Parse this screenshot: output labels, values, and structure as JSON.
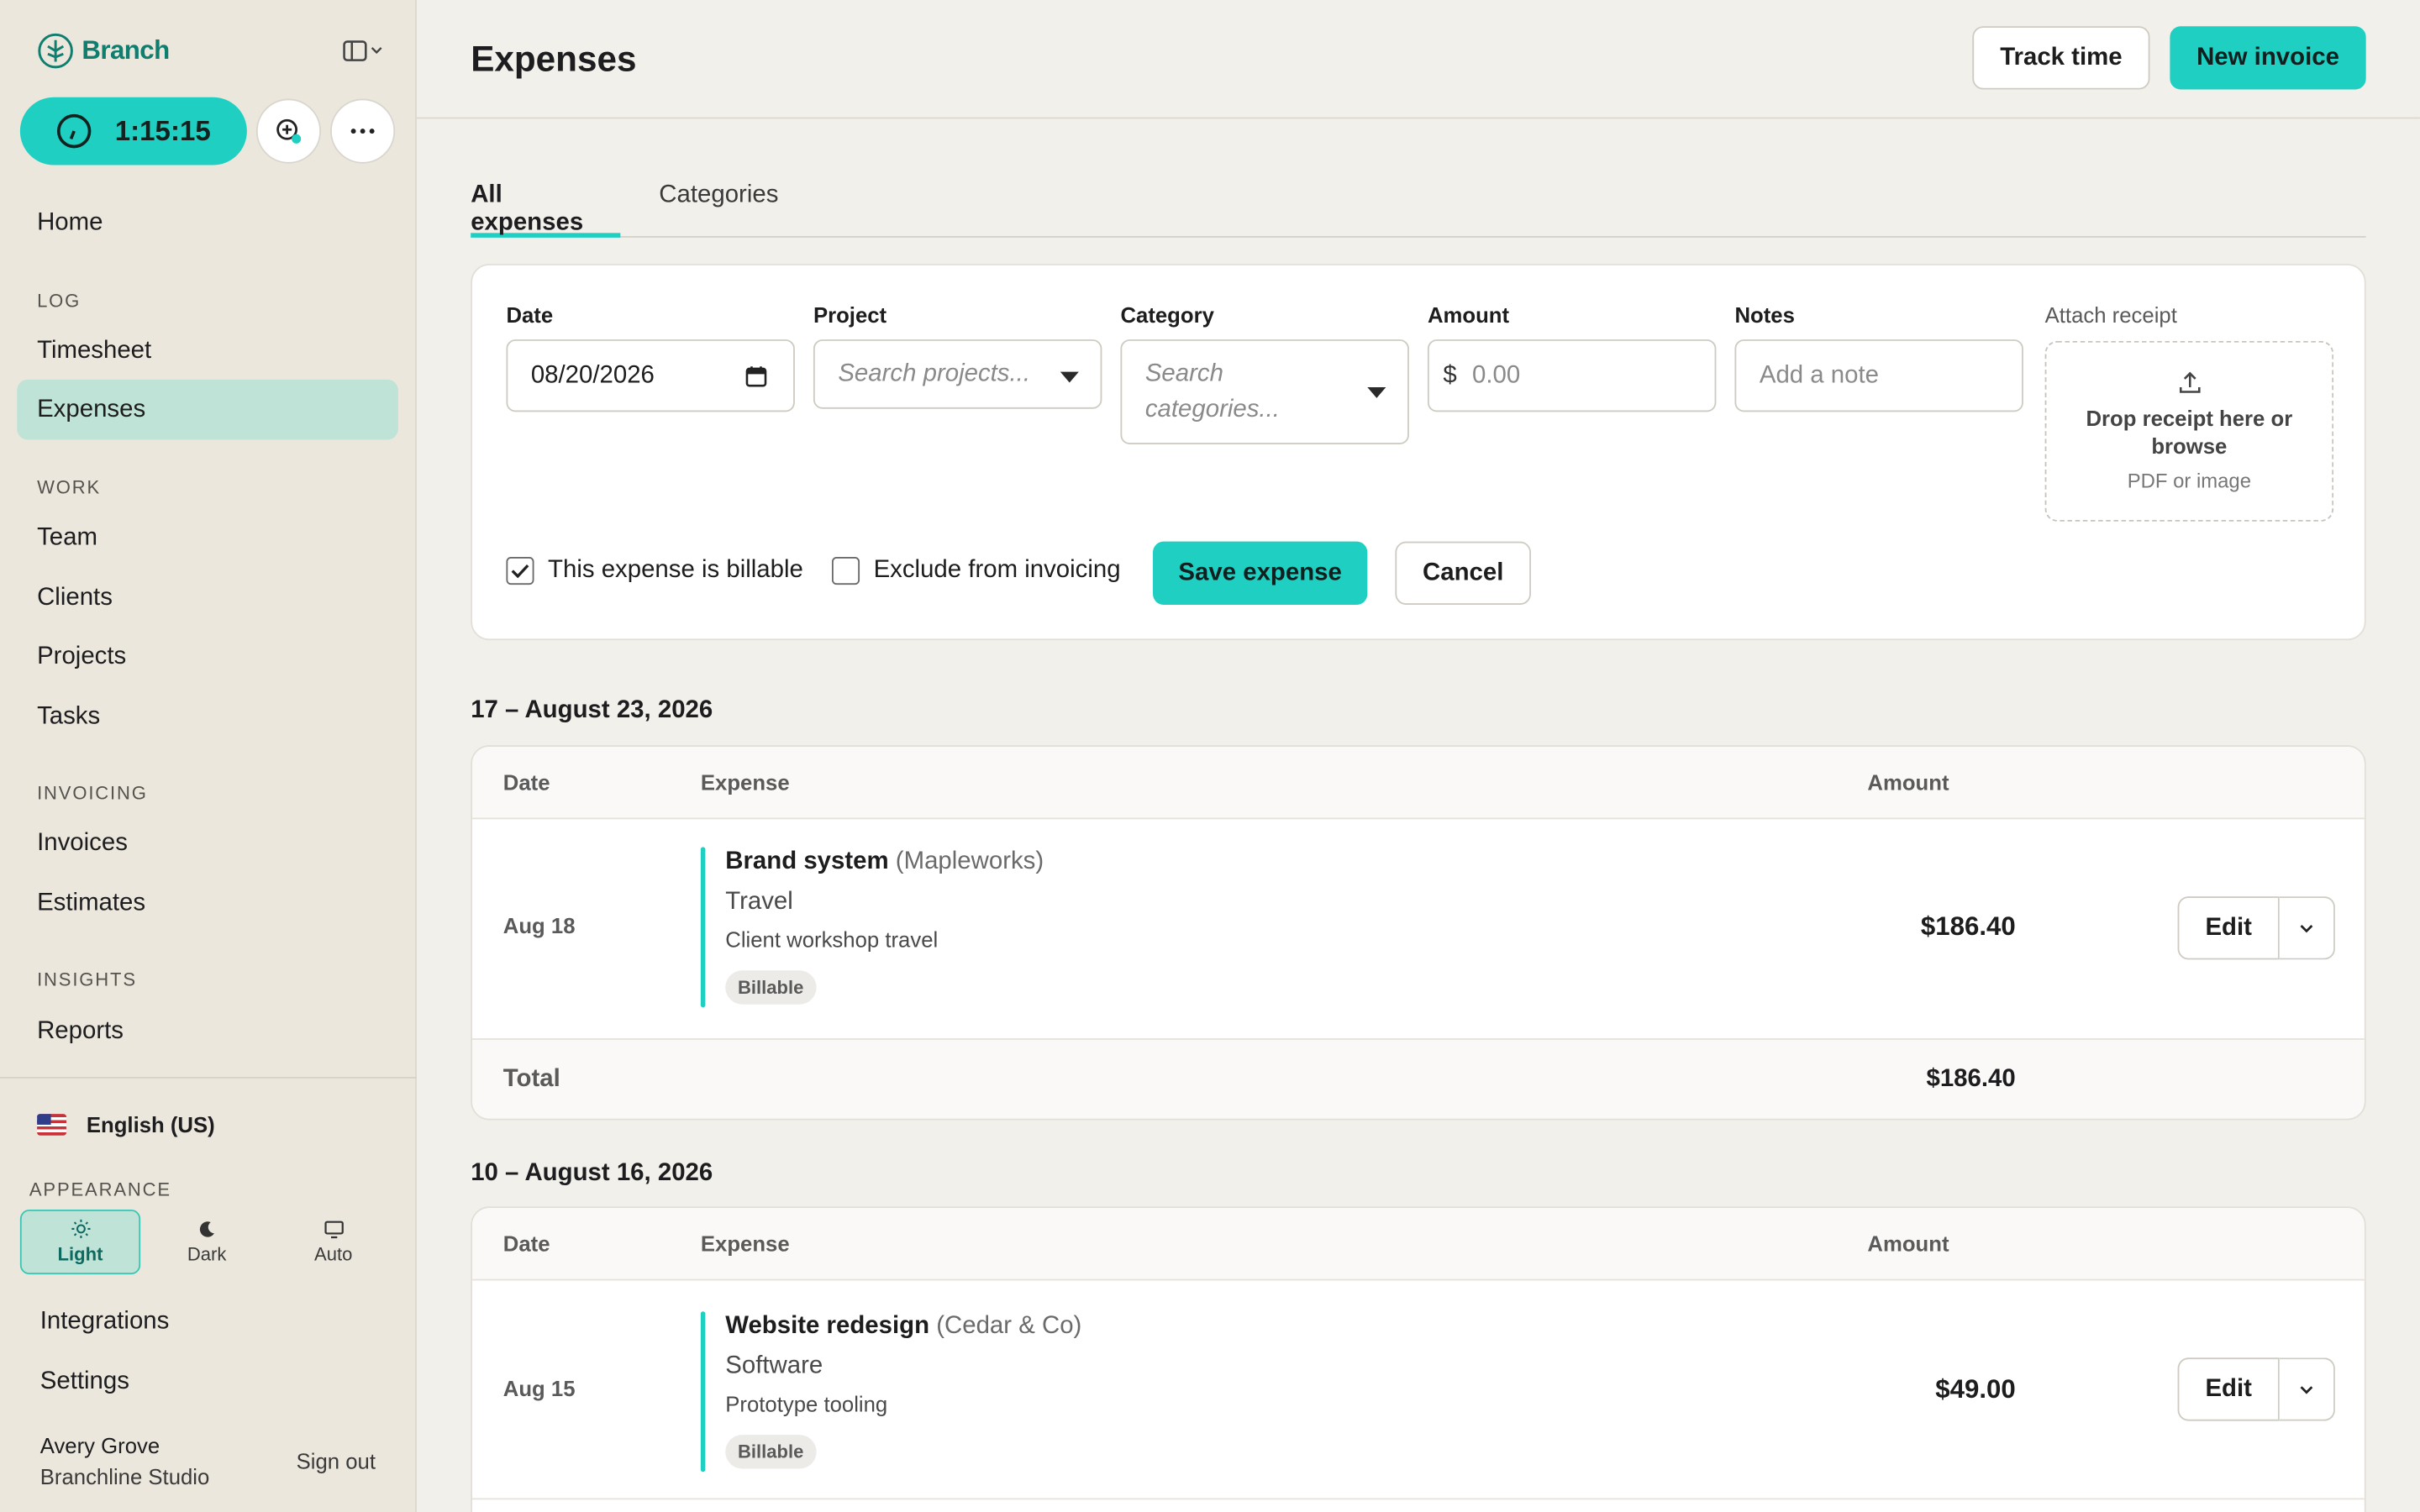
{
  "app": {
    "name": "Branch"
  },
  "sidebar": {
    "timer": "1:15:15",
    "nav": {
      "home": "Home",
      "log_section": "LOG",
      "timesheet": "Timesheet",
      "expenses": "Expenses",
      "work_section": "WORK",
      "team": "Team",
      "clients": "Clients",
      "projects": "Projects",
      "tasks": "Tasks",
      "invoicing_section": "INVOICING",
      "invoices": "Invoices",
      "estimates": "Estimates",
      "insights_section": "INSIGHTS",
      "reports": "Reports"
    },
    "language": "English (US)",
    "appearance": {
      "label": "APPEARANCE",
      "light": "Light",
      "dark": "Dark",
      "auto": "Auto",
      "selected": "Light"
    },
    "integrations": "Integrations",
    "settings": "Settings",
    "user": {
      "name": "Avery Grove",
      "org": "Branchline Studio",
      "sign_out": "Sign out"
    }
  },
  "header": {
    "title": "Expenses",
    "track_time": "Track time",
    "new_invoice": "New invoice"
  },
  "tabs": {
    "all": "All expenses",
    "categories": "Categories",
    "active": "All expenses"
  },
  "form": {
    "date": {
      "label": "Date",
      "value": "08/20/2026"
    },
    "project": {
      "label": "Project",
      "placeholder": "Search projects..."
    },
    "category": {
      "label": "Category",
      "placeholder": "Search categories..."
    },
    "amount": {
      "label": "Amount",
      "currency": "$",
      "placeholder": "0.00"
    },
    "notes": {
      "label": "Notes",
      "placeholder": "Add a note"
    },
    "receipt": {
      "label": "Attach receipt",
      "title": "Drop receipt here or browse",
      "subtitle": "PDF or image"
    },
    "billable": {
      "label": "This expense is billable",
      "checked": true
    },
    "exclude": {
      "label": "Exclude from invoicing",
      "checked": false
    },
    "save": "Save expense",
    "cancel": "Cancel"
  },
  "weeks": [
    {
      "title": "17 – August 23, 2026",
      "columns": {
        "date": "Date",
        "expense": "Expense",
        "amount": "Amount"
      },
      "rows": [
        {
          "date": "Aug 18",
          "project": "Brand system",
          "client": "(Mapleworks)",
          "category": "Travel",
          "note": "Client workshop travel",
          "badge": "Billable",
          "amount": "$186.40",
          "edit": "Edit"
        }
      ],
      "total_label": "Total",
      "total": "$186.40"
    },
    {
      "title": "10 – August 16, 2026",
      "columns": {
        "date": "Date",
        "expense": "Expense",
        "amount": "Amount"
      },
      "rows": [
        {
          "date": "Aug 15",
          "project": "Website redesign",
          "client": "(Cedar & Co)",
          "category": "Software",
          "note": "Prototype tooling",
          "badge": "Billable",
          "amount": "$49.00",
          "edit": "Edit"
        }
      ]
    }
  ],
  "colors": {
    "accent": "#1ecfc2",
    "brand": "#0f7e6f",
    "active_nav": "#bfe3d7",
    "sidebar_bg": "#ebe7dd",
    "page_bg": "#f2f0eb"
  }
}
